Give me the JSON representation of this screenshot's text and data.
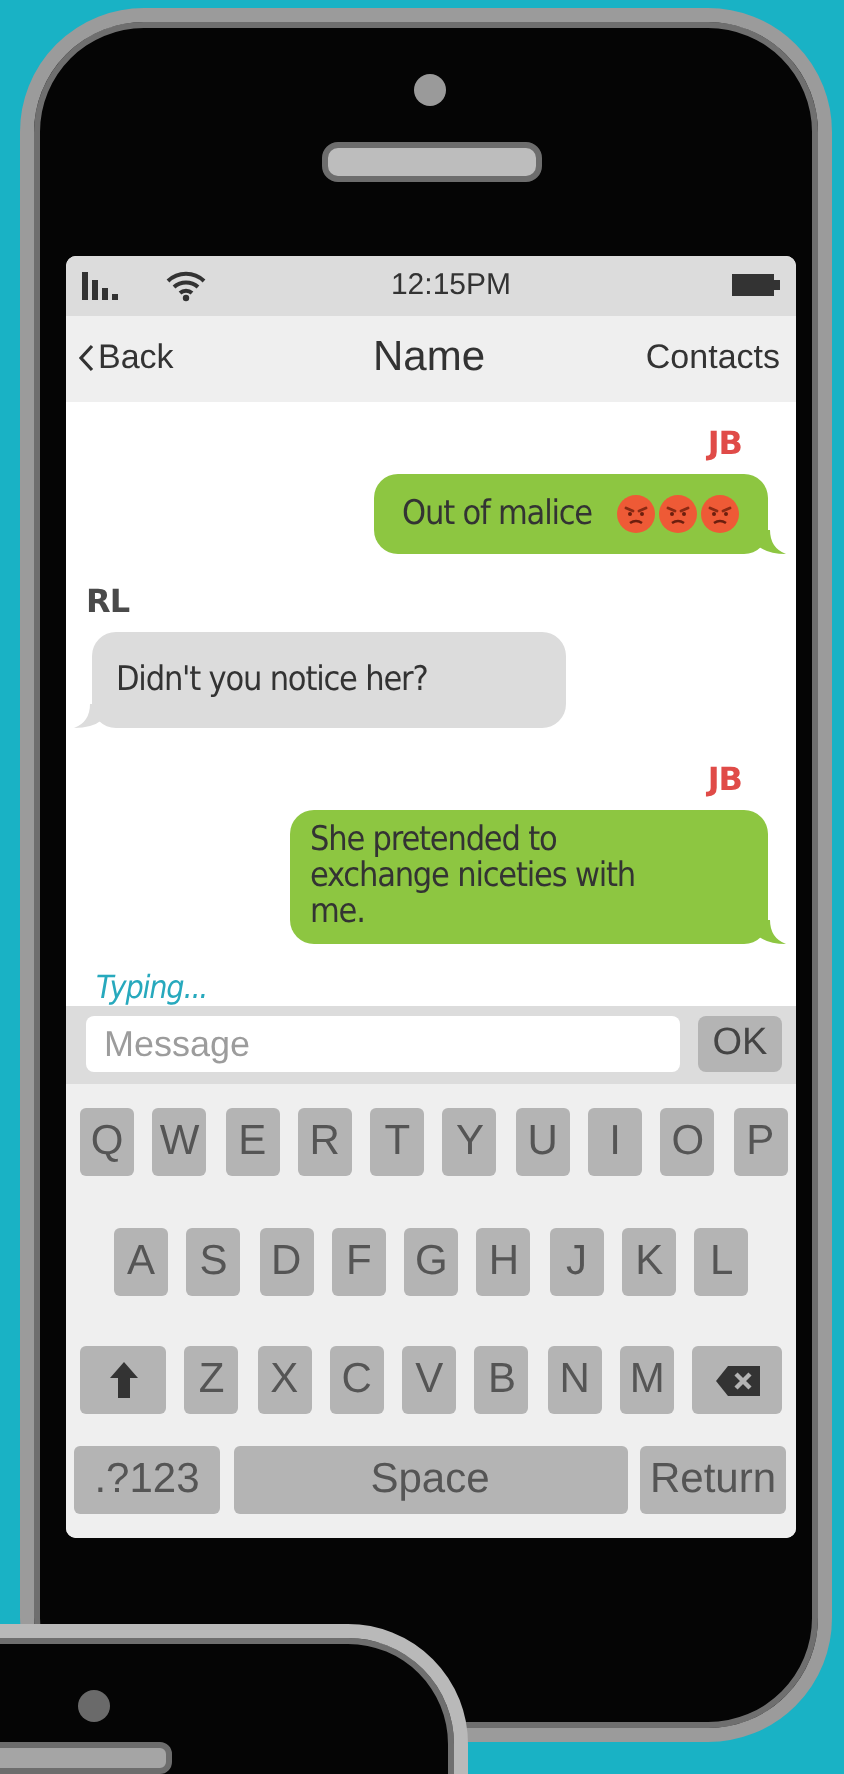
{
  "status_bar": {
    "time": "12:15PM"
  },
  "nav": {
    "back": "Back",
    "title": "Name",
    "action": "Contacts"
  },
  "messages": [
    {
      "sender": "JB",
      "text": "Out of malice",
      "outgoing": true,
      "icons": [
        {
          "kind": "angry"
        },
        {
          "kind": "angry"
        },
        {
          "kind": "angry"
        }
      ]
    },
    {
      "sender": "RL",
      "text": "Didn't you notice her?",
      "outgoing": false
    },
    {
      "sender": "JB",
      "text": "She pretended to exchange niceties with me.",
      "outgoing": true
    }
  ],
  "typing": "Typing...",
  "composer": {
    "placeholder": "Message",
    "button": "OK"
  },
  "keyboard": {
    "rows": [
      {
        "keys": [
          {
            "kind": "char",
            "label": "Q"
          },
          {
            "kind": "char",
            "label": "W"
          },
          {
            "kind": "char",
            "label": "E"
          },
          {
            "kind": "char",
            "label": "R"
          },
          {
            "kind": "char",
            "label": "T"
          },
          {
            "kind": "char",
            "label": "Y"
          },
          {
            "kind": "char",
            "label": "U"
          },
          {
            "kind": "char",
            "label": "I"
          },
          {
            "kind": "char",
            "label": "O"
          },
          {
            "kind": "char",
            "label": "P"
          }
        ]
      },
      {
        "keys": [
          {
            "kind": "char",
            "label": "A"
          },
          {
            "kind": "char",
            "label": "S"
          },
          {
            "kind": "char",
            "label": "D"
          },
          {
            "kind": "char",
            "label": "F"
          },
          {
            "kind": "char",
            "label": "G"
          },
          {
            "kind": "char",
            "label": "H"
          },
          {
            "kind": "char",
            "label": "J"
          },
          {
            "kind": "char",
            "label": "K"
          },
          {
            "kind": "char",
            "label": "L"
          }
        ]
      },
      {
        "keys": [
          {
            "kind": "shift"
          },
          {
            "kind": "char",
            "label": "Z"
          },
          {
            "kind": "char",
            "label": "X"
          },
          {
            "kind": "char",
            "label": "C"
          },
          {
            "kind": "char",
            "label": "V"
          },
          {
            "kind": "char",
            "label": "B"
          },
          {
            "kind": "char",
            "label": "N"
          },
          {
            "kind": "char",
            "label": "M"
          },
          {
            "kind": "delete"
          }
        ]
      },
      {
        "keys": [
          {
            "kind": "symbols",
            "label": ".?123"
          },
          {
            "kind": "space",
            "label": "Space"
          },
          {
            "kind": "return",
            "label": "Return"
          }
        ]
      }
    ]
  }
}
